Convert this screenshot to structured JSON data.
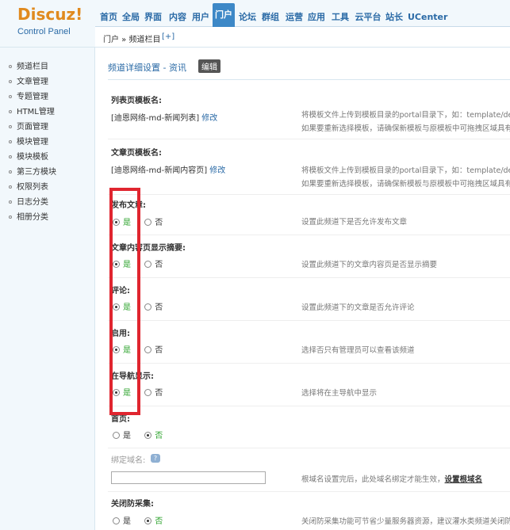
{
  "logo": {
    "brand": "Discuz!",
    "subtitle": "Control Panel"
  },
  "topnav": [
    "首页",
    "全局",
    "界面",
    "内容",
    "用户",
    "门户",
    "论坛",
    "群组",
    "运营",
    "应用",
    "工具",
    "云平台",
    "站长",
    "UCenter"
  ],
  "breadcrumb": {
    "text": "门户 » 频道栏目",
    "add": "[+]"
  },
  "sidebar": [
    "频道栏目",
    "文章管理",
    "专题管理",
    "HTML管理",
    "页面管理",
    "模块管理",
    "模块模板",
    "第三方模块",
    "权限列表",
    "日志分类",
    "相册分类"
  ],
  "page": {
    "title": "频道详细设置 - 资讯",
    "edit_label": "编辑"
  },
  "list_template": {
    "label": "列表页模板名:",
    "value": "[迪恩网络-md-新闻列表]",
    "edit": "修改",
    "hint1": "将模板文件上传到模板目录的portal目录下，如：template/defa",
    "hint2": "如果要重新选择模板，请确保新模板与原模板中可拖拽区域具有相"
  },
  "article_template": {
    "label": "文章页模板名:",
    "value": "[迪恩网络-md-新闻内容页]",
    "edit": "修改",
    "hint1": "将模板文件上传到模板目录的portal目录下，如：template/defa",
    "hint2": "如果要重新选择模板，请确保新模板与原模板中可拖拽区域具有相"
  },
  "radios": {
    "yes": "是",
    "no": "否",
    "publish": {
      "label": "发布文章:",
      "hint": "设置此频道下是否允许发布文章",
      "value": "是"
    },
    "summary": {
      "label": "文章内容页显示摘要:",
      "hint": "设置此频道下的文章内容页是否显示摘要",
      "value": "是"
    },
    "comment": {
      "label": "评论:",
      "hint": "设置此频道下的文章是否允许评论",
      "value": "是"
    },
    "enable": {
      "label": "启用:",
      "hint": "选择否只有管理员可以查看该频道",
      "value": "是"
    },
    "in_nav": {
      "label": "在导航显示:",
      "hint": "选择将在主导航中显示",
      "value": "是"
    },
    "home": {
      "label": "首页:",
      "value": "否"
    }
  },
  "domain": {
    "label": "绑定域名:",
    "value": "",
    "hint": "根域名设置完后，此处域名绑定才能生效，",
    "hint_link": "设置根域名"
  },
  "anti_collect": {
    "label": "关闭防采集:",
    "value": "否",
    "hint": "关闭防采集功能可节省少量服务器资源，建议灌水类频道关闭防"
  },
  "colors": {
    "accent": "#3d88c7",
    "highlight": "#e0252f",
    "selected": "#2aa22a"
  }
}
